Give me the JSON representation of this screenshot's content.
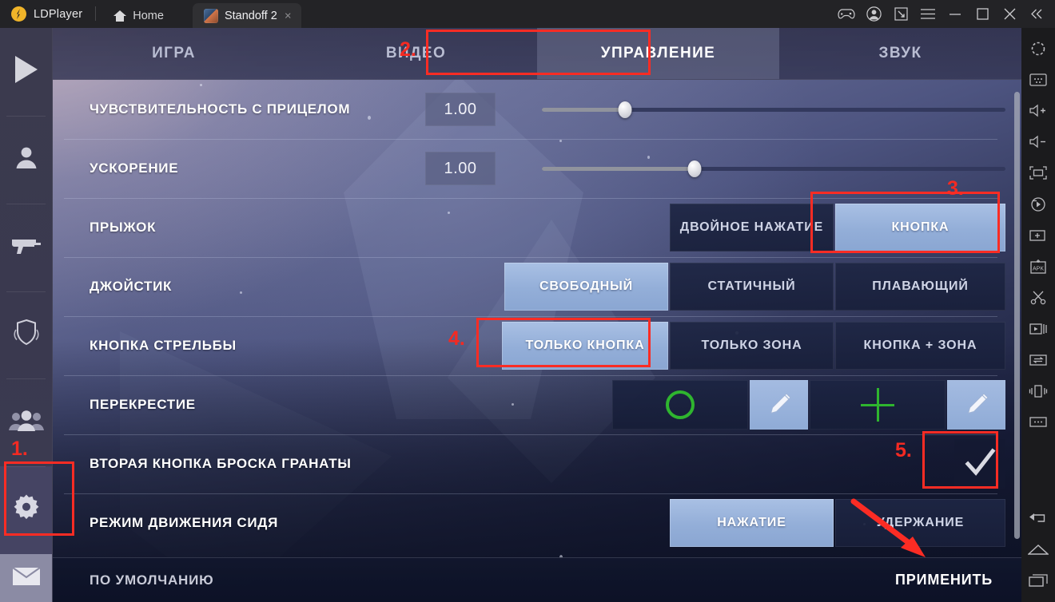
{
  "window": {
    "brand": "LDPlayer",
    "tabs": [
      {
        "label": "Home",
        "icon": "home-icon",
        "active": false
      },
      {
        "label": "Standoff 2",
        "icon": "game-icon",
        "active": true,
        "close": "×"
      }
    ],
    "controls": [
      {
        "name": "gamepad-icon"
      },
      {
        "name": "account-icon"
      },
      {
        "name": "resize-icon"
      },
      {
        "name": "menu-icon"
      },
      {
        "name": "minimize-icon"
      },
      {
        "name": "maximize-icon"
      },
      {
        "name": "close-icon"
      },
      {
        "name": "collapse-icon"
      }
    ]
  },
  "right_toolbar": [
    {
      "name": "fullscreen-icon"
    },
    {
      "name": "keyboard-mapping-icon"
    },
    {
      "name": "volume-up-icon"
    },
    {
      "name": "volume-down-icon"
    },
    {
      "name": "screenshot-icon"
    },
    {
      "name": "rotate-icon"
    },
    {
      "name": "add-window-icon"
    },
    {
      "name": "install-apk-icon"
    },
    {
      "name": "scissors-icon"
    },
    {
      "name": "video-record-icon"
    },
    {
      "name": "file-transfer-icon"
    },
    {
      "name": "shake-icon"
    },
    {
      "name": "more-icon"
    },
    {
      "name": "back-nav-icon"
    },
    {
      "name": "home-nav-icon"
    },
    {
      "name": "recents-nav-icon"
    }
  ],
  "game": {
    "rail": [
      {
        "name": "play-icon"
      },
      {
        "name": "profile-icon"
      },
      {
        "name": "weapons-icon"
      },
      {
        "name": "rank-icon"
      },
      {
        "name": "friends-icon"
      },
      {
        "name": "settings-icon",
        "selected": true
      },
      {
        "name": "mail-icon"
      }
    ],
    "tabs": [
      {
        "label": "ИГРА",
        "active": false
      },
      {
        "label": "ВИДЕО",
        "active": false
      },
      {
        "label": "УПРАВЛЕНИЕ",
        "active": true
      },
      {
        "label": "ЗВУК",
        "active": false
      }
    ],
    "rows": [
      {
        "id": "aim-sensitivity",
        "label": "ЧУВСТВИТЕЛЬНОСТЬ С ПРИЦЕЛОМ",
        "type": "slider",
        "value": "1.00",
        "knob_percent": 18
      },
      {
        "id": "acceleration",
        "label": "УСКОРЕНИЕ",
        "type": "slider",
        "value": "1.00",
        "knob_percent": 33
      },
      {
        "id": "jump",
        "label": "ПРЫЖОК",
        "type": "options",
        "options": [
          {
            "label": "ДВОЙНОЕ НАЖАТИЕ",
            "selected": false
          },
          {
            "label": "КНОПКА",
            "selected": true
          }
        ]
      },
      {
        "id": "joystick",
        "label": "ДЖОЙСТИК",
        "type": "options",
        "options": [
          {
            "label": "СВОБОДНЫЙ",
            "selected": true
          },
          {
            "label": "СТАТИЧНЫЙ",
            "selected": false
          },
          {
            "label": "ПЛАВАЮЩИЙ",
            "selected": false
          }
        ]
      },
      {
        "id": "fire-button",
        "label": "КНОПКА СТРЕЛЬБЫ",
        "type": "options",
        "options": [
          {
            "label": "ТОЛЬКО КНОПКА",
            "selected": true
          },
          {
            "label": "ТОЛЬКО ЗОНА",
            "selected": false
          },
          {
            "label": "КНОПКА + ЗОНА",
            "selected": false
          }
        ]
      },
      {
        "id": "crosshair",
        "label": "ПЕРЕКРЕСТИЕ",
        "type": "crosshair"
      },
      {
        "id": "second-grenade-button",
        "label": "ВТОРАЯ КНОПКА БРОСКА ГРАНАТЫ",
        "type": "checkbox",
        "checked": true
      },
      {
        "id": "crouch-move-mode",
        "label": "РЕЖИМ ДВИЖЕНИЯ СИДЯ",
        "type": "options",
        "options": [
          {
            "label": "НАЖАТИЕ",
            "selected": true
          },
          {
            "label": "УДЕРЖАНИЕ",
            "selected": false
          }
        ]
      }
    ],
    "footer": {
      "default_label": "ПО УМОЛЧАНИЮ",
      "apply_label": "ПРИМЕНИТЬ"
    }
  },
  "annotations": {
    "accent_color": "#fb2c24",
    "steps": [
      {
        "number": "1.",
        "target": "settings-rail-item"
      },
      {
        "number": "2.",
        "target": "controls-tab"
      },
      {
        "number": "3.",
        "target": "jump-button-option"
      },
      {
        "number": "4.",
        "target": "fire-only-button-option"
      },
      {
        "number": "5.",
        "target": "second-grenade-checkbox"
      }
    ],
    "arrow_target": "apply-button"
  }
}
